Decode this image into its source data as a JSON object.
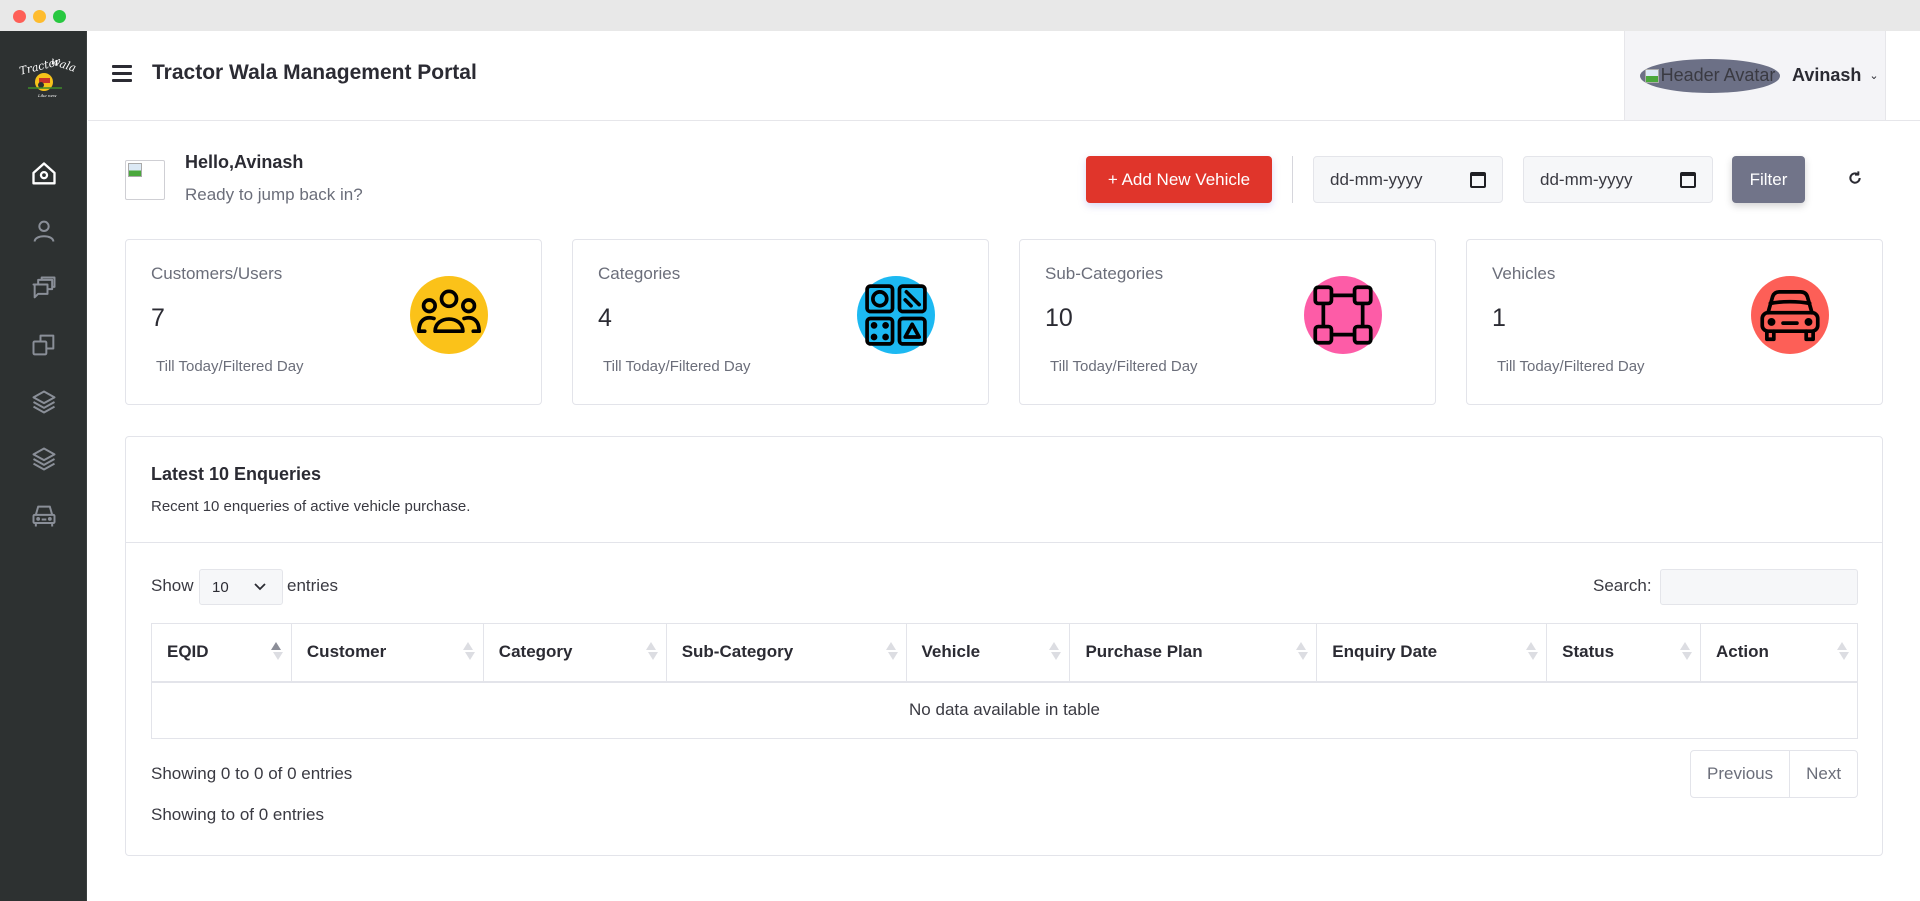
{
  "window": {
    "controls": [
      "close",
      "minimize",
      "maximize"
    ]
  },
  "sidebar": {
    "logo_alt": "Tractor Wala logo",
    "items": [
      {
        "id": "home",
        "icon": "home-icon",
        "active": true
      },
      {
        "id": "users",
        "icon": "user-icon",
        "active": false
      },
      {
        "id": "enquiries",
        "icon": "chat-icon",
        "active": false
      },
      {
        "id": "categories",
        "icon": "copy-icon",
        "active": false
      },
      {
        "id": "sub-categories",
        "icon": "layers-icon",
        "active": false
      },
      {
        "id": "layers-2",
        "icon": "layers-icon",
        "active": false
      },
      {
        "id": "vehicles",
        "icon": "car-icon",
        "active": false
      }
    ]
  },
  "header": {
    "title": "Tractor Wala Management Portal",
    "avatar_alt": "Header Avatar",
    "user_name": "Avinash"
  },
  "greeting": {
    "hello": "Hello,Avinash",
    "subtitle": "Ready to jump back in?"
  },
  "toolbar": {
    "add_label": "+ Add New Vehicle",
    "date_from_placeholder": "dd-mm-yyyy",
    "date_to_placeholder": "dd-mm-yyyy",
    "filter_label": "Filter",
    "refresh_icon": "refresh-icon"
  },
  "stats": [
    {
      "label": "Customers/Users",
      "value": "7",
      "footer": "Till Today/Filtered Day",
      "icon": "users-group-icon",
      "color": "#fbc219"
    },
    {
      "label": "Categories",
      "value": "4",
      "footer": "Till Today/Filtered Day",
      "icon": "category-grid-icon",
      "color": "#1cb9f2"
    },
    {
      "label": "Sub-Categories",
      "value": "10",
      "footer": "Till Today/Filtered Day",
      "icon": "sitemap-icon",
      "color": "#fd5ca7"
    },
    {
      "label": "Vehicles",
      "value": "1",
      "footer": "Till Today/Filtered Day",
      "icon": "car-icon",
      "color": "#fd5f57"
    }
  ],
  "enquiries": {
    "title": "Latest 10 Enqueries",
    "subtitle": "Recent 10 enqueries of active vehicle purchase.",
    "show_label": "Show",
    "page_length": "10",
    "entries_label": "entries",
    "search_label": "Search:",
    "search_value": "",
    "columns": [
      "EQID",
      "Customer",
      "Category",
      "Sub-Category",
      "Vehicle",
      "Purchase Plan",
      "Enquiry Date",
      "Status",
      "Action"
    ],
    "empty_message": "No data available in table",
    "info": "Showing 0 to 0 of 0 entries",
    "info_secondary": "Showing to of 0 entries",
    "previous_label": "Previous",
    "next_label": "Next"
  }
}
